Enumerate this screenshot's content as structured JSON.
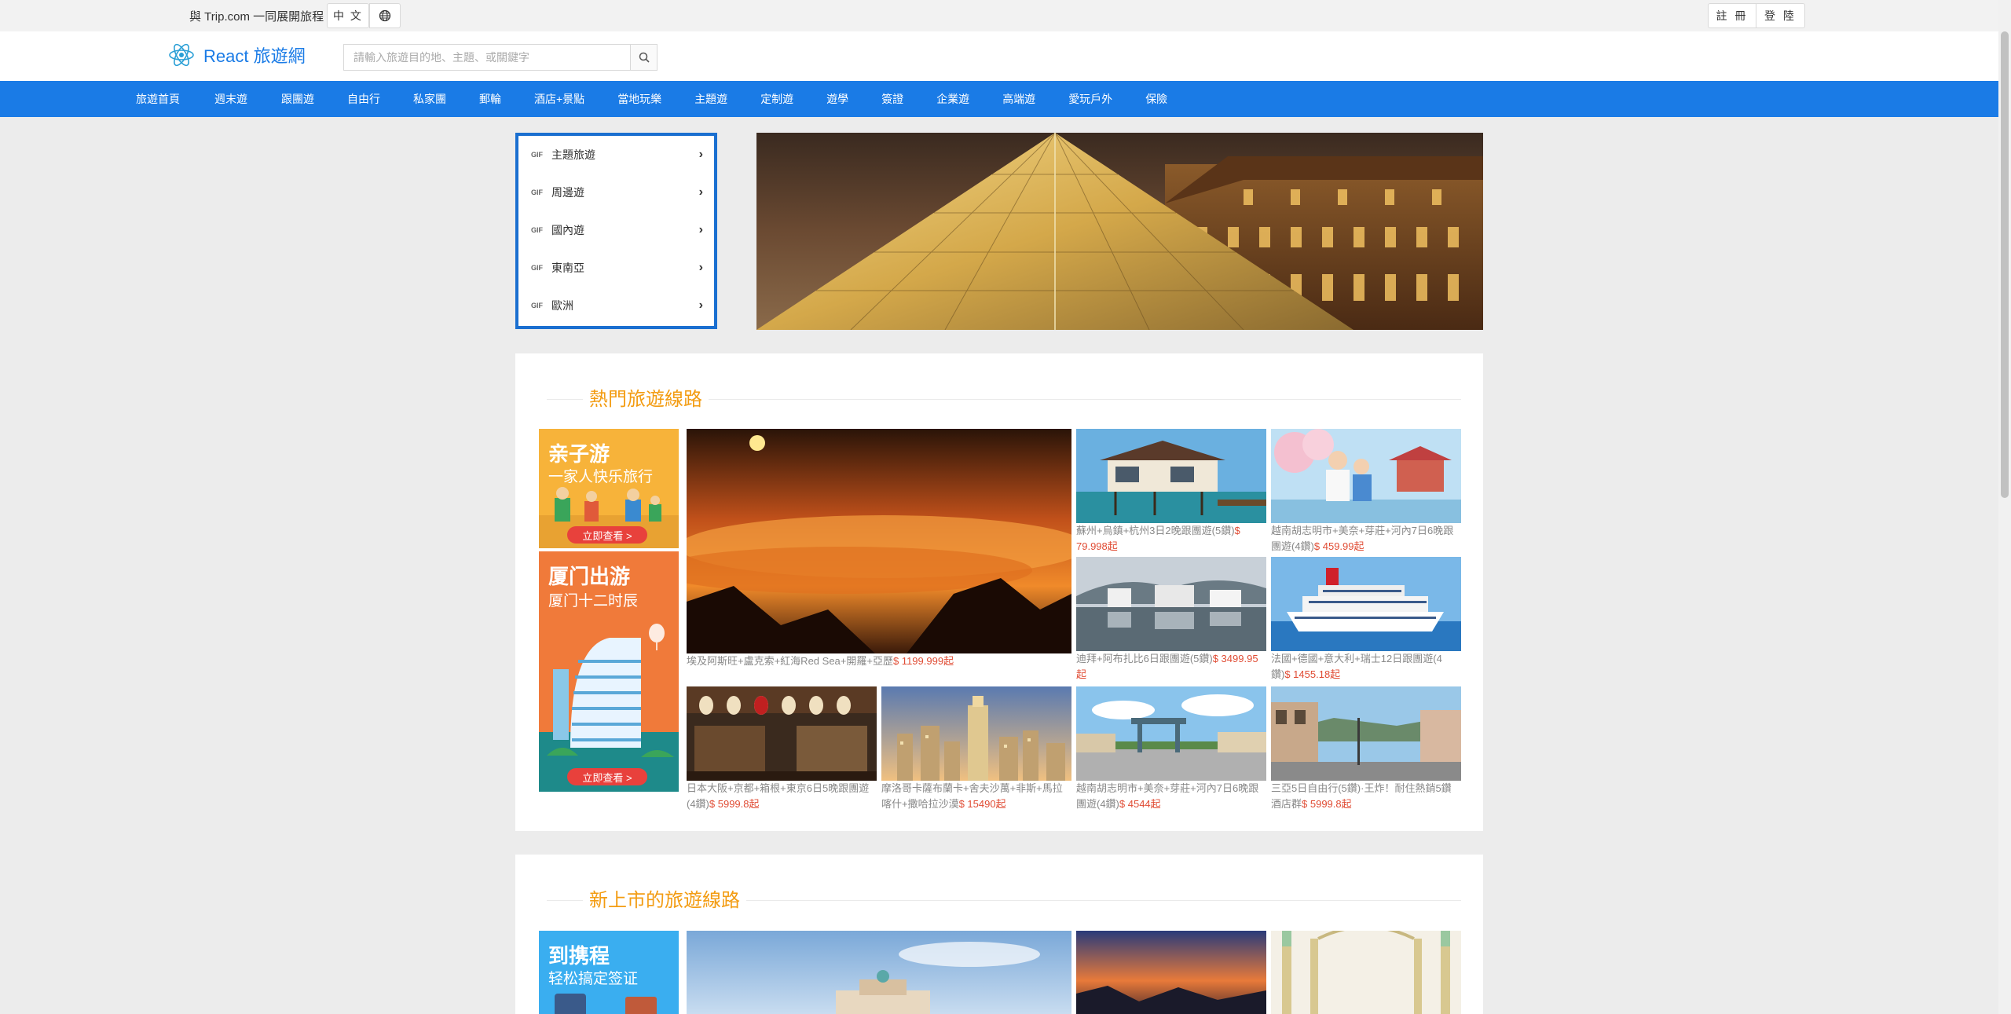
{
  "topbar": {
    "slogan": "與 Trip.com 一同展開旅程",
    "language": "中 文",
    "register": "註 冊",
    "login": "登 陸"
  },
  "header": {
    "logo_text": "React 旅遊網",
    "search_placeholder": "請輸入旅遊目的地、主題、或關鍵字"
  },
  "nav": {
    "items": [
      "旅遊首頁",
      "週末遊",
      "跟團遊",
      "自由行",
      "私家團",
      "郵輪",
      "酒店+景點",
      "當地玩樂",
      "主題遊",
      "定制遊",
      "遊學",
      "簽證",
      "企業遊",
      "高端遊",
      "愛玩戶外",
      "保險"
    ]
  },
  "side_menu": {
    "items": [
      {
        "tag": "GIF",
        "label": "主題旅遊"
      },
      {
        "tag": "GIF",
        "label": "周邊遊"
      },
      {
        "tag": "GIF",
        "label": "國內遊"
      },
      {
        "tag": "GIF",
        "label": "東南亞"
      },
      {
        "tag": "GIF",
        "label": "歐洲"
      }
    ]
  },
  "section_hot": {
    "title": "熱門旅遊線路",
    "promo1": {
      "title": "亲子游",
      "sub": "一家人快乐旅行",
      "button": "立即查看 >"
    },
    "promo2": {
      "title": "厦门出游",
      "sub": "厦门十二时辰",
      "button": "立即查看 >"
    },
    "products": [
      {
        "name": "埃及阿斯旺+盧克索+紅海Red Sea+開羅+亞歷",
        "price": "$ 1199.999起"
      },
      {
        "name": "蘇州+烏鎮+杭州3日2晚跟團遊(5鑽)",
        "price": "$ 79.998起"
      },
      {
        "name": "越南胡志明市+美奈+芽莊+河內7日6晚跟團遊(4鑽)",
        "price": "$ 459.99起"
      },
      {
        "name": "迪拜+阿布扎比6日跟團遊(5鑽)",
        "price": "$ 3499.95起"
      },
      {
        "name": "法國+德國+意大利+瑞士12日跟團遊(4鑽)",
        "price": "$ 1455.18起"
      },
      {
        "name": "日本大阪+京都+箱根+東京6日5晚跟團遊(4鑽)",
        "price": "$ 5999.8起"
      },
      {
        "name": "摩洛哥卡薩布蘭卡+舍夫沙萬+非斯+馬拉喀什+撒哈拉沙漠",
        "price": "$ 15490起"
      },
      {
        "name": "越南胡志明市+美奈+芽莊+河內7日6晚跟團遊(4鑽)",
        "price": "$ 4544起"
      },
      {
        "name": "三亞5日自由行(5鑽)·王炸！耐住熱銷5鑽酒店群",
        "price": "$ 5999.8起"
      }
    ]
  },
  "section_new": {
    "title": "新上市的旅遊線路",
    "promo1": {
      "title": "到携程",
      "sub": "轻松搞定签证"
    }
  },
  "colors": {
    "brand_blue": "#1a7be6",
    "section_title_orange": "#f39c12",
    "price_red": "#e04c34"
  },
  "icons": [
    "globe-icon",
    "react-logo-icon",
    "search-icon",
    "chevron-right-icon"
  ]
}
